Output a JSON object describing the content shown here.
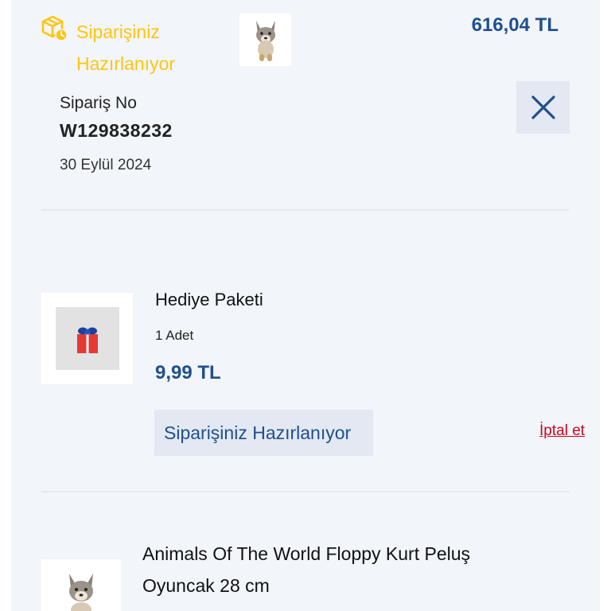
{
  "order": {
    "status": "Siparişiniz Hazırlanıyor",
    "total": "616,04 TL",
    "order_no_label": "Sipariş No",
    "order_no": "W129838232",
    "date": "30 Eylül 2024"
  },
  "items": [
    {
      "name": "Hediye Paketi",
      "quantity": "1 Adet",
      "price": "9,99 TL",
      "status": "Siparişiniz Hazırlanıyor",
      "cancel_label": "İptal et"
    },
    {
      "name": "Animals Of The World Floppy Kurt Peluş Oyuncak 28 cm"
    }
  ],
  "icons": {
    "status": "package-clock-icon",
    "close": "close-icon"
  },
  "colors": {
    "status_yellow": "#ffc50f",
    "price_blue": "#1f4f8e",
    "cancel_red": "#d0021b",
    "panel_bg": "#f2f5fa",
    "chip_bg": "#e3e8f2"
  }
}
